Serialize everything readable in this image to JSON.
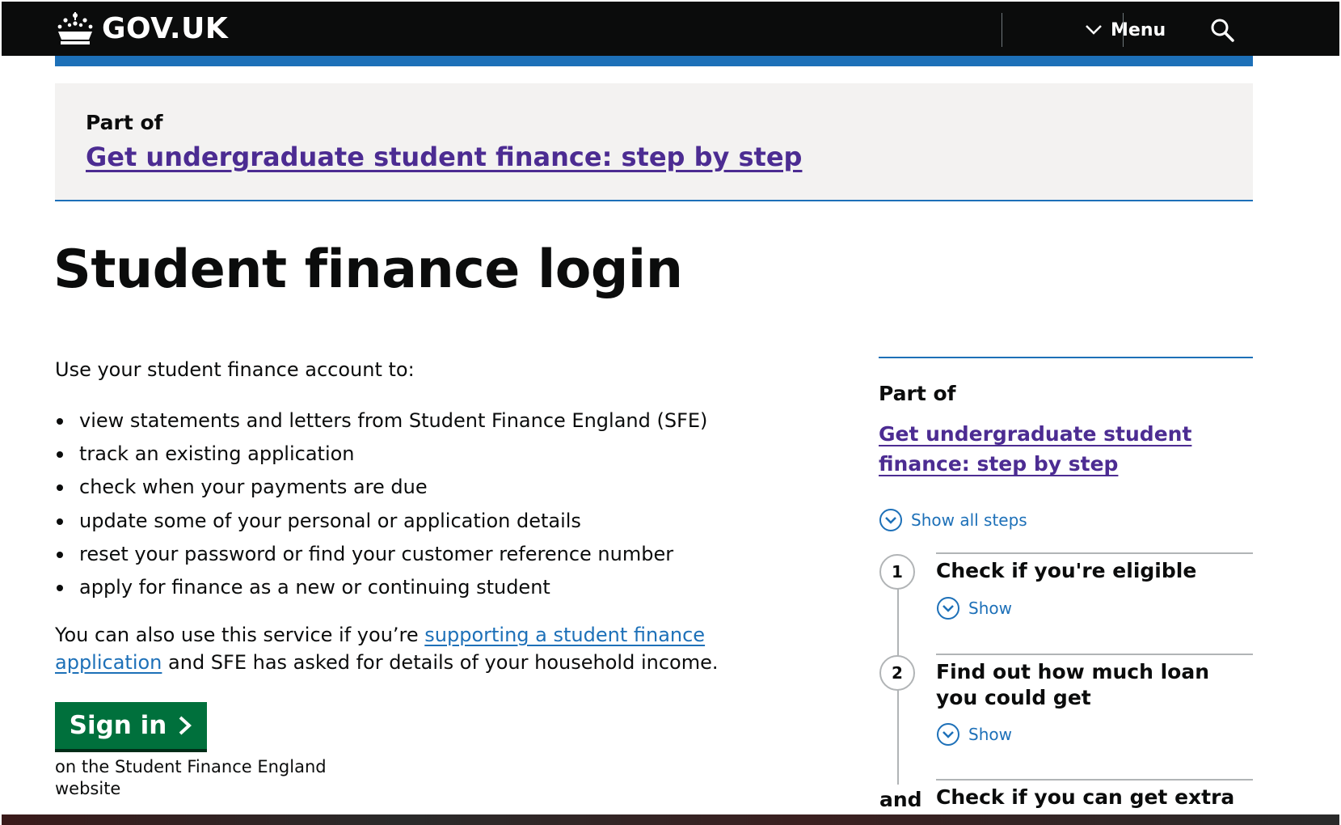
{
  "header": {
    "logo_text": "GOV.UK",
    "menu_label": "Menu",
    "menu_icon": "chevron-down-icon",
    "search_icon": "search-icon"
  },
  "banner": {
    "part_of": "Part of",
    "link_text": "Get undergraduate student finance: step by step"
  },
  "main": {
    "title": "Student finance login",
    "intro": "Use your student finance account to:",
    "bullets": [
      "view statements and letters from Student Finance England (SFE)",
      "track an existing application",
      "check when your payments are due",
      "update some of your personal or application details",
      "reset your password or find your customer reference number",
      "apply for finance as a new or continuing student"
    ],
    "also_prefix": "You can also use this service if you’re ",
    "also_link": "supporting a student finance application",
    "also_suffix": " and SFE has asked for details of your household income.",
    "signin_label": "Sign in",
    "signin_note": "on the Student Finance England website"
  },
  "sidebar": {
    "part_of": "Part of",
    "link_text": "Get undergraduate student finance: step by step",
    "show_all": "Show all steps",
    "steps": [
      {
        "number": "1",
        "title": "Check if you're eligible",
        "show": "Show"
      },
      {
        "number": "2",
        "title": "Find out how much loan you could get",
        "show": "Show"
      },
      {
        "number": "and",
        "title": "Check if you can get extra"
      }
    ]
  },
  "colors": {
    "header_bg": "#0b0c0c",
    "accent_blue": "#1d70b8",
    "link_purple": "#4c2c92",
    "button_green": "#00703c",
    "banner_bg": "#f3f2f1"
  }
}
